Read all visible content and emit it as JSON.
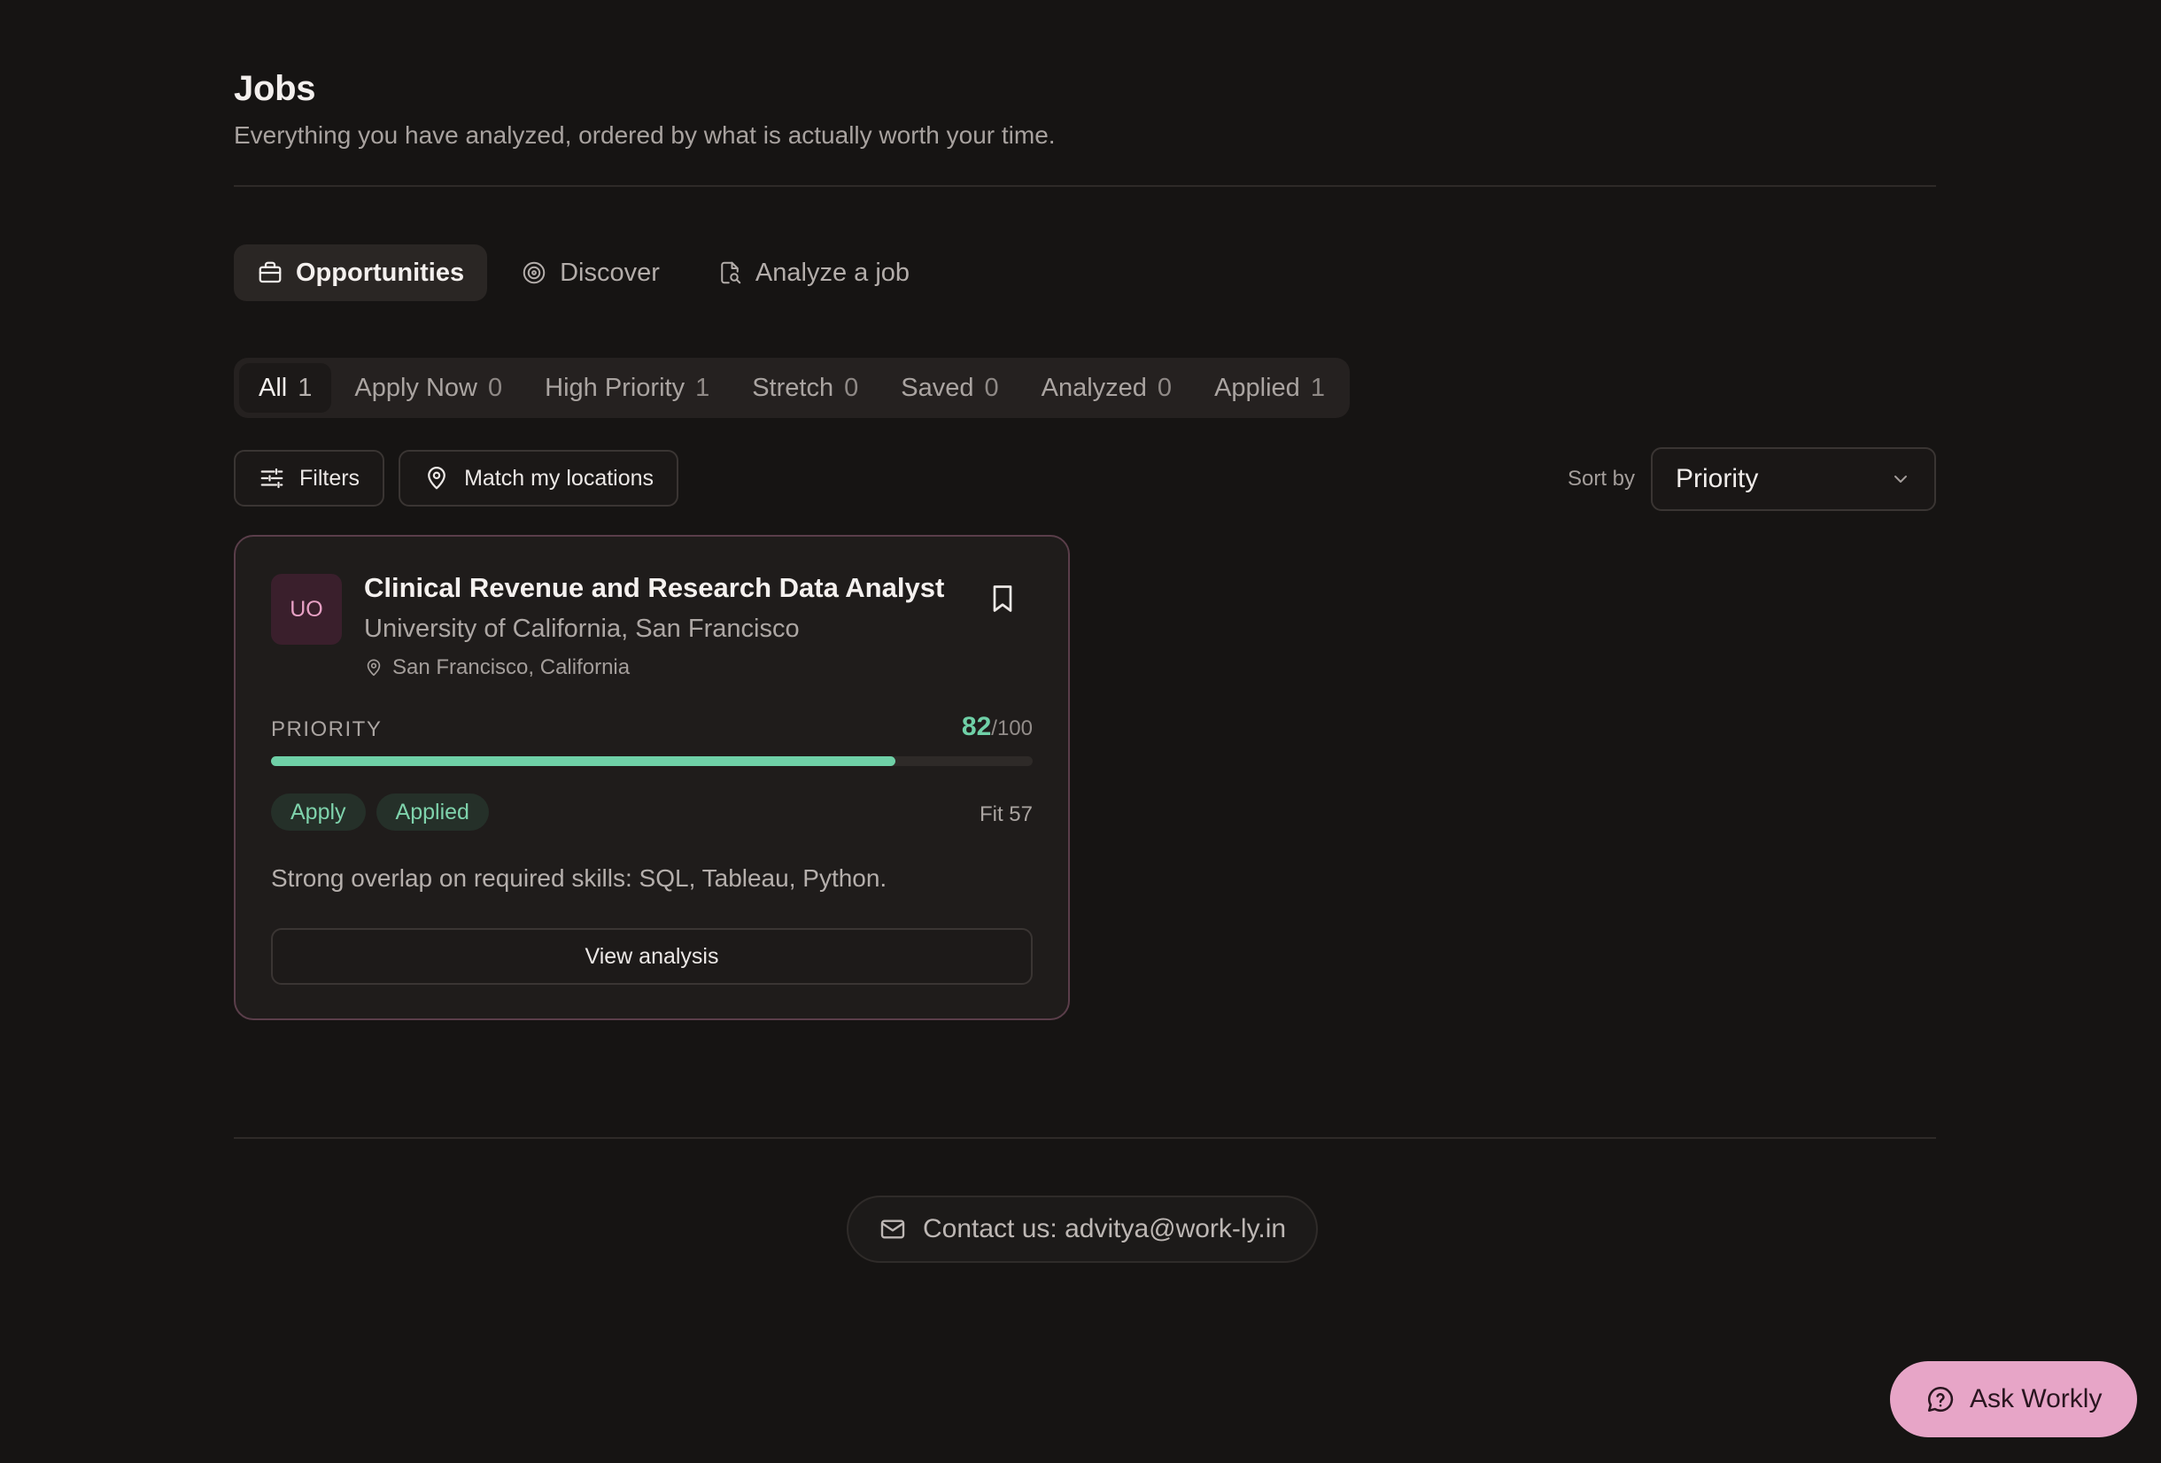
{
  "header": {
    "title": "Jobs",
    "subtitle": "Everything you have analyzed, ordered by what is actually worth your time."
  },
  "nav_tabs": [
    {
      "label": "Opportunities",
      "icon": "briefcase-icon",
      "active": true
    },
    {
      "label": "Discover",
      "icon": "target-icon",
      "active": false
    },
    {
      "label": "Analyze a job",
      "icon": "document-search-icon",
      "active": false
    }
  ],
  "segments": [
    {
      "label": "All",
      "count": "1",
      "active": true
    },
    {
      "label": "Apply Now",
      "count": "0"
    },
    {
      "label": "High Priority",
      "count": "1"
    },
    {
      "label": "Stretch",
      "count": "0"
    },
    {
      "label": "Saved",
      "count": "0"
    },
    {
      "label": "Analyzed",
      "count": "0"
    },
    {
      "label": "Applied",
      "count": "1"
    }
  ],
  "toolbar": {
    "filters_label": "Filters",
    "match_locations_label": "Match my locations"
  },
  "sort": {
    "label": "Sort by",
    "value": "Priority"
  },
  "job": {
    "initials": "UO",
    "title": "Clinical Revenue and Research Data Analyst",
    "company": "University of California, San Francisco",
    "location": "San Francisco, California",
    "priority_label": "PRIORITY",
    "score": "82",
    "score_max": "/100",
    "priority_fraction": 0.82,
    "tags": [
      "Apply",
      "Applied"
    ],
    "fit": "Fit 57",
    "summary": "Strong overlap on required skills: SQL, Tableau, Python.",
    "view_label": "View analysis"
  },
  "footer": {
    "contact": "Contact us: advitya@work-ly.in"
  },
  "assistant": {
    "label": "Ask Workly"
  },
  "colors": {
    "background": "#161413",
    "accent_green": "#6fd0a7",
    "accent_pink": "#e7a5c7",
    "card_border": "#5a3e4a"
  }
}
